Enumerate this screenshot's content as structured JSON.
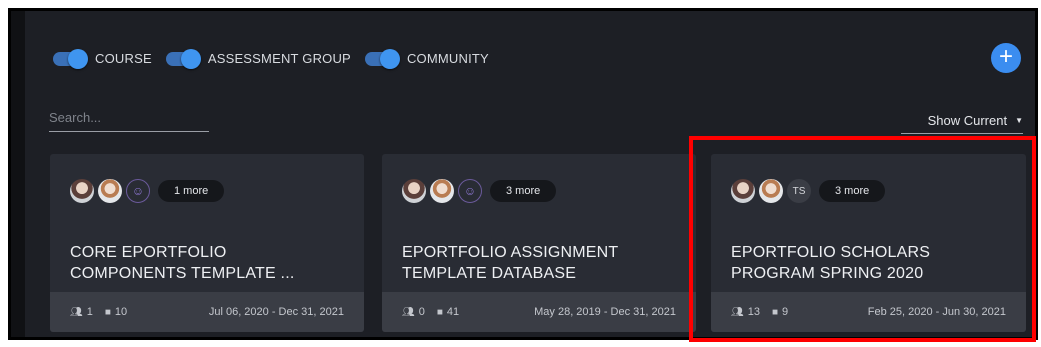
{
  "filters": [
    {
      "label": "COURSE",
      "on": true
    },
    {
      "label": "ASSESSMENT GROUP",
      "on": true
    },
    {
      "label": "COMMUNITY",
      "on": true
    }
  ],
  "add_button": {
    "glyph": "+"
  },
  "search": {
    "placeholder": "Search..."
  },
  "view_select": {
    "value": "Show Current"
  },
  "cards": [
    {
      "avatar_badge": "1 more",
      "title": "CORE EPORTFOLIO COMPONENTS TEMPLATE ...",
      "members": "1",
      "items": "10",
      "dates": "Jul 06, 2020 - Dec 31, 2021"
    },
    {
      "avatar_badge": "3 more",
      "title": "EPORTFOLIO ASSIGNMENT TEMPLATE DATABASE",
      "members": "0",
      "items": "41",
      "dates": "May 28, 2019 - Dec 31, 2021"
    },
    {
      "avatar_initials": "TS",
      "avatar_badge": "3 more",
      "title": "EPORTFOLIO SCHOLARS PROGRAM SPRING 2020",
      "members": "13",
      "items": "9",
      "dates": "Feb 25, 2020 - Jun 30, 2021"
    }
  ],
  "colors": {
    "accent": "#3b8df0",
    "highlight": "#ff0000",
    "card": "#292c34",
    "footer": "#3a3d45"
  }
}
